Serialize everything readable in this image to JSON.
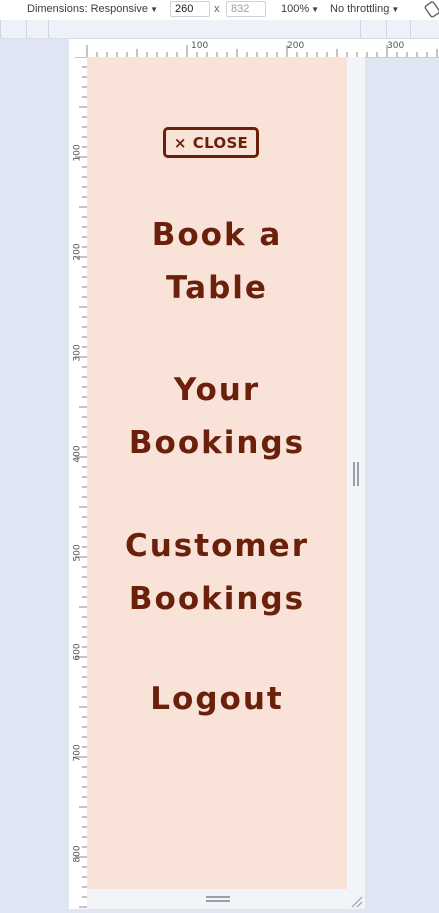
{
  "devtools": {
    "dimensions_label": "Dimensions: Responsive",
    "width_value": "260",
    "times": "x",
    "height_value": "832",
    "zoom": "100%",
    "throttling": "No throttling",
    "caret_icon": "chevron-down-icon",
    "rotate_icon": "rotate-icon",
    "ruler_horizontal_labels": [
      "100",
      "200",
      "300"
    ],
    "ruler_vertical_labels": [
      "100",
      "200",
      "300",
      "400",
      "500",
      "600",
      "700",
      "800"
    ]
  },
  "nav_overlay": {
    "close_icon": "×",
    "close_label": "CLOSE",
    "items": [
      {
        "line1": "Book a",
        "line2": "Table"
      },
      {
        "line1": "Your",
        "line2": "Bookings"
      },
      {
        "line1": "Customer",
        "line2": "Bookings"
      },
      {
        "line1": "Logout",
        "line2": ""
      }
    ]
  },
  "colors": {
    "overlay_background": "#f9e3d9",
    "brand_text": "#6b200c",
    "devtools_background": "#dfe5f3"
  }
}
